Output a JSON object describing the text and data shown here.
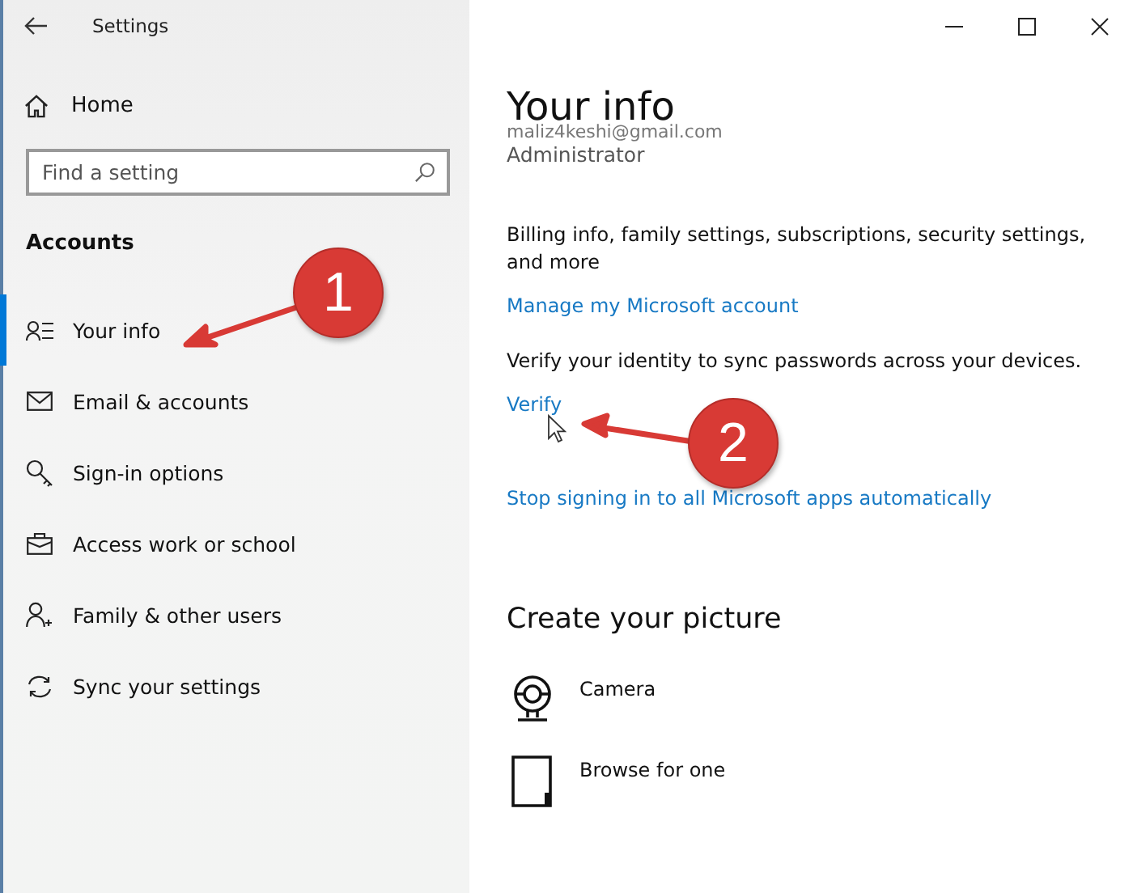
{
  "window": {
    "title": "Settings"
  },
  "sidebar": {
    "home": "Home",
    "search": {
      "placeholder": "Find a setting"
    },
    "section": "Accounts",
    "items": [
      {
        "label": "Your info",
        "selected": true
      },
      {
        "label": "Email & accounts",
        "selected": false
      },
      {
        "label": "Sign-in options",
        "selected": false
      },
      {
        "label": "Access work or school",
        "selected": false
      },
      {
        "label": "Family & other users",
        "selected": false
      },
      {
        "label": "Sync your settings",
        "selected": false
      }
    ]
  },
  "content": {
    "title": "Your info",
    "email": "maliz4keshi@gmail.com",
    "role": "Administrator",
    "billing_text": "Billing info, family settings, subscriptions, security settings, and more",
    "manage_link": "Manage my Microsoft account",
    "verify_text": "Verify your identity to sync passwords across your devices.",
    "verify_link": "Verify",
    "stop_link": "Stop signing in to all Microsoft apps automatically",
    "picture_heading": "Create your picture",
    "picture_options": [
      {
        "label": "Camera"
      },
      {
        "label": "Browse for one"
      }
    ]
  },
  "annotations": [
    {
      "number": "1"
    },
    {
      "number": "2"
    }
  ]
}
